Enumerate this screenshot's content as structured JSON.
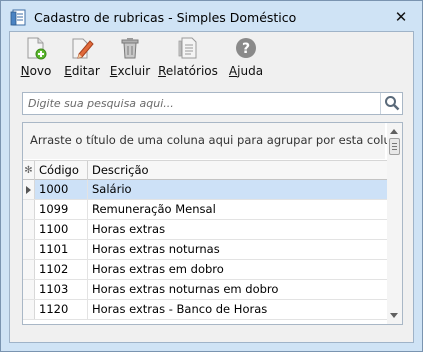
{
  "window": {
    "title": "Cadastro de rubricas - Simples Doméstico",
    "close_glyph": "✕"
  },
  "toolbar": {
    "buttons": [
      {
        "label": "Novo",
        "icon": "new-document-icon"
      },
      {
        "label": "Editar",
        "icon": "edit-pencil-icon"
      },
      {
        "label": "Excluir",
        "icon": "trash-icon"
      },
      {
        "label": "Relatórios",
        "icon": "report-icon"
      },
      {
        "label": "Ajuda",
        "icon": "help-icon"
      }
    ]
  },
  "search": {
    "placeholder": "Digite sua pesquisa aqui...",
    "value": "",
    "icon": "search-icon"
  },
  "grid": {
    "group_hint": "Arraste o título de uma coluna aqui para agrupar por esta coluna",
    "indicator_header": "✻",
    "columns": [
      "Código",
      "Descrição"
    ],
    "rows": [
      {
        "codigo": "1000",
        "descricao": "Salário"
      },
      {
        "codigo": "1099",
        "descricao": "Remuneração Mensal"
      },
      {
        "codigo": "1100",
        "descricao": "Horas extras"
      },
      {
        "codigo": "1101",
        "descricao": "Horas extras noturnas"
      },
      {
        "codigo": "1102",
        "descricao": "Horas extras em dobro"
      },
      {
        "codigo": "1103",
        "descricao": "Horas extras noturnas em dobro"
      },
      {
        "codigo": "1120",
        "descricao": "Horas extras - Banco de Horas"
      }
    ],
    "selected_row": 0
  },
  "colors": {
    "window_frame": "#cfe3f5",
    "selection": "#cde1f7",
    "accent_green": "#5cb82e",
    "help_gray": "#8a8a8a"
  }
}
